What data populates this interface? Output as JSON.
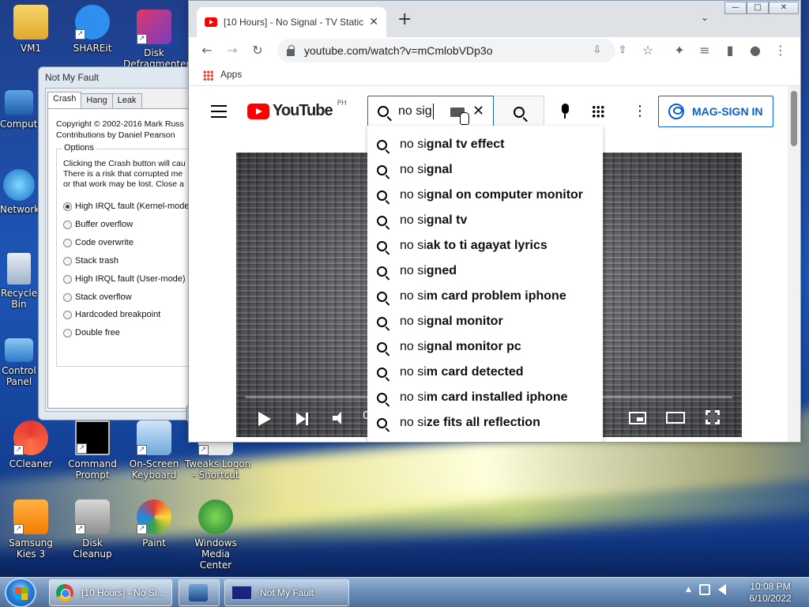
{
  "desktop": {
    "icons": [
      {
        "label": "VM1"
      },
      {
        "label": "SHAREit"
      },
      {
        "label": "Disk Defragmenter"
      },
      {
        "label": "Computer"
      },
      {
        "label": "Network"
      },
      {
        "label": "Recycle Bin"
      },
      {
        "label": "Control Panel"
      },
      {
        "label": "CCleaner"
      },
      {
        "label": "Command Prompt"
      },
      {
        "label": "On-Screen Keyboard"
      },
      {
        "label": "Tweaks.Logon - Shortcut"
      },
      {
        "label": "Samsung Kies 3"
      },
      {
        "label": "Disk Cleanup"
      },
      {
        "label": "Paint"
      },
      {
        "label": "Windows Media Center"
      }
    ]
  },
  "notmyfault": {
    "title": "Not My Fault",
    "tabs": [
      "Crash",
      "Hang",
      "Leak"
    ],
    "copyright": "Copyright © 2002-2016 Mark Russ",
    "contributions": "Contributions by Daniel Pearson",
    "options_label": "Options",
    "warning_lines": [
      "Clicking the Crash button will cau",
      "There is a risk that corrupted me",
      "or that work may be lost. Close a"
    ],
    "options": [
      {
        "label": "High IRQL fault (Kernel-mode",
        "selected": true
      },
      {
        "label": "Buffer overflow",
        "selected": false
      },
      {
        "label": "Code overwrite",
        "selected": false
      },
      {
        "label": "Stack trash",
        "selected": false
      },
      {
        "label": "High IRQL fault (User-mode)",
        "selected": false
      },
      {
        "label": "Stack overflow",
        "selected": false
      },
      {
        "label": "Hardcoded breakpoint",
        "selected": false
      },
      {
        "label": "Double free",
        "selected": false
      }
    ]
  },
  "chrome": {
    "tab_title": "[10 Hours] - No Signal - TV Static",
    "tab_close": "✕",
    "new_tab": "+",
    "tab_search": "⌄",
    "window_buttons": {
      "minimize": "—",
      "maximize": "□",
      "close": "✕"
    },
    "url": "youtube.com/watch?v=mCmlobVDp3o",
    "bookmarks_apps": "Apps"
  },
  "youtube": {
    "logo_text": "YouTube",
    "country_code": "PH",
    "search_query": "no sig",
    "clear_glyph": "✕",
    "more_glyph": "⋮",
    "signin_label": "MAG-SIGN IN",
    "player_time": "0",
    "suggestions": [
      {
        "typed": "no si",
        "rest": "gnal tv effect"
      },
      {
        "typed": "no si",
        "rest": "gnal"
      },
      {
        "typed": "no si",
        "rest": "gnal on computer monitor"
      },
      {
        "typed": "no si",
        "rest": "gnal tv"
      },
      {
        "typed": "no si",
        "rest": "ak to ti agayat lyrics"
      },
      {
        "typed": "no si",
        "rest": "gned"
      },
      {
        "typed": "no si",
        "rest": "m card problem iphone"
      },
      {
        "typed": "no si",
        "rest": "gnal monitor"
      },
      {
        "typed": "no si",
        "rest": "gnal monitor pc"
      },
      {
        "typed": "no si",
        "rest": "m card detected"
      },
      {
        "typed": "no si",
        "rest": "m card installed iphone"
      },
      {
        "typed": "no si",
        "rest": "ze fits all reflection"
      }
    ]
  },
  "taskbar": {
    "chrome_task": "[10 Hours] - No Si...",
    "nmf_task": "Not My Fault",
    "time": "10:08 PM",
    "date": "6/10/2022",
    "tray_arrow": "▲"
  }
}
